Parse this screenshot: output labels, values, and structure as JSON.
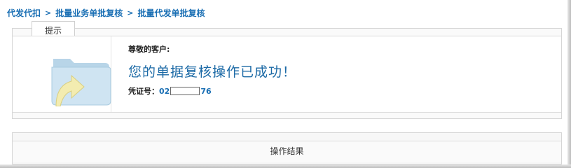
{
  "breadcrumb": {
    "items": [
      "代发代扣",
      "批量业务单批复核",
      "批量代发单批复核"
    ],
    "separator": ">"
  },
  "tip": {
    "tab_label": "提示",
    "greeting": "尊敬的客户:",
    "success_message": "您的单据复核操作已成功！",
    "voucher_label": "凭证号：",
    "voucher_prefix": "02",
    "voucher_suffix": "76",
    "icon": "folder-arrow-icon"
  },
  "result": {
    "header": "操作结果"
  },
  "colors": {
    "link": "#1a6fb4",
    "success_text": "#1c6aa6"
  }
}
